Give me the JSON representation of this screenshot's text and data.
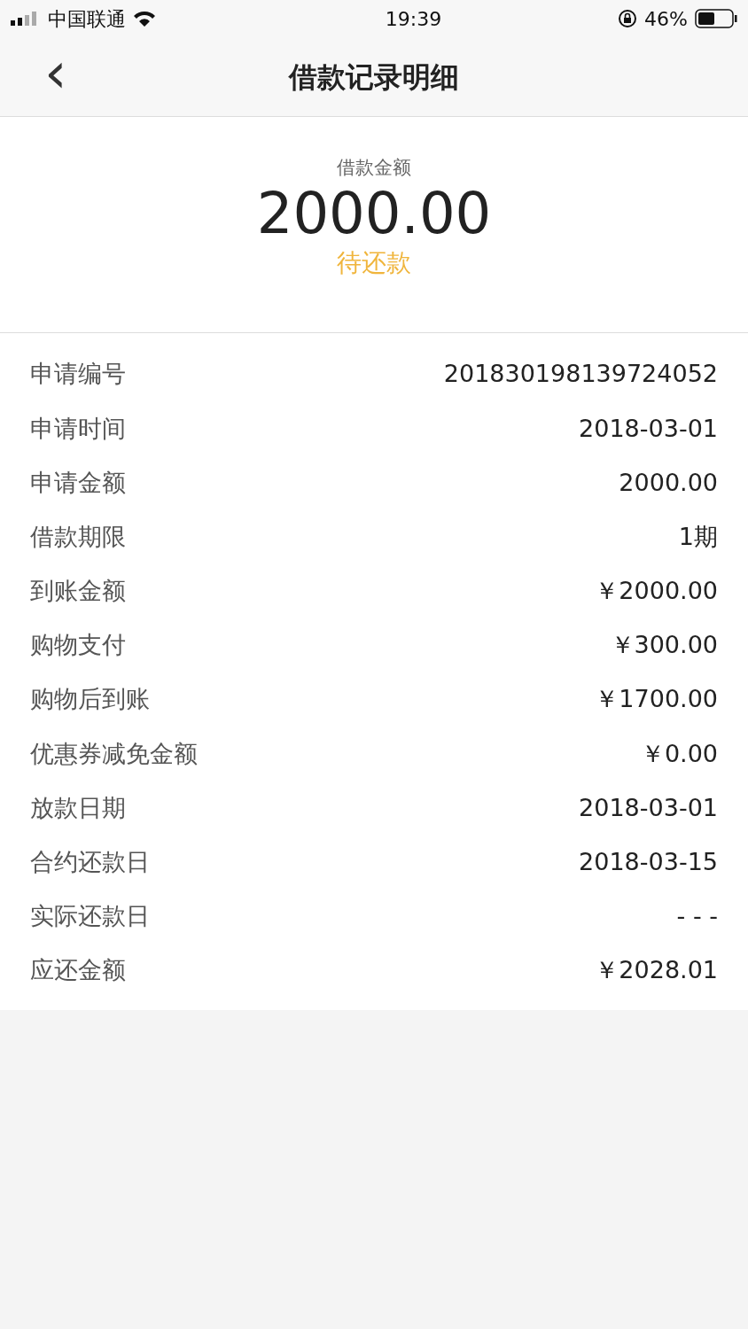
{
  "status_bar": {
    "carrier": "中国联通",
    "time": "19:39",
    "battery_percent": "46%"
  },
  "nav": {
    "back": "‹",
    "title": "借款记录明细"
  },
  "summary": {
    "label": "借款金额",
    "amount": "2000.00",
    "status": "待还款"
  },
  "details": [
    {
      "label": "申请编号",
      "value": "201830198139724052"
    },
    {
      "label": "申请时间",
      "value": "2018-03-01"
    },
    {
      "label": "申请金额",
      "value": "2000.00"
    },
    {
      "label": "借款期限",
      "value": "1期"
    },
    {
      "label": "到账金额",
      "value": "￥2000.00"
    },
    {
      "label": "购物支付",
      "value": "￥300.00"
    },
    {
      "label": "购物后到账",
      "value": "￥1700.00"
    },
    {
      "label": "优惠券减免金额",
      "value": "￥0.00"
    },
    {
      "label": "放款日期",
      "value": "2018-03-01"
    },
    {
      "label": "合约还款日",
      "value": "2018-03-15"
    },
    {
      "label": "实际还款日",
      "value": "- - -"
    },
    {
      "label": "应还金额",
      "value": "￥2028.01"
    }
  ]
}
